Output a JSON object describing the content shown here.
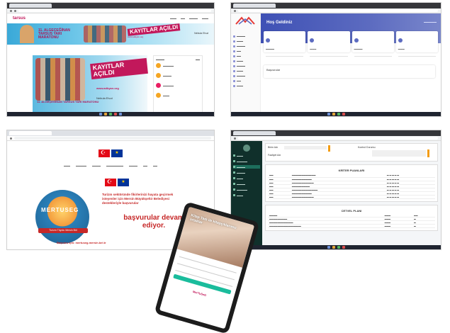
{
  "screen1": {
    "banner_title": "11. ALGEÇEĞİNAN TARSUS YARI MARATONU",
    "banner_cta": "KAYITLAR AÇILDI",
    "banner_web": "www.adkyarı.org",
    "banner_brand": "Nebula Eivət",
    "poster_cta": "KAYITLAR AÇILDI",
    "poster_title": "11. ALGEÇEĞİNAN TARSUS YARI MARATONU",
    "poster_web": "www.adkyarı.org",
    "poster_brand": "Nebula Eivət",
    "logo": "tarsus"
  },
  "screen2": {
    "header_title": "Hoş Geldiniz",
    "section_title": "Başvurular"
  },
  "screen3": {
    "hero_logo": "MERTUSEG",
    "hero_ribbon": "Turizm Tüyolu Mersin Bül",
    "hero_text1": "Turizm sektöründe fikirlerinizi hayata geçirmek isteyenler için Mersin Büyükşehir Belediyesi destekleriyle başvurular",
    "hero_text2": "başvurular devam ediyor.",
    "footer_text": "Başvuru için: mertuseg.mersin.bel.tr"
  },
  "screen4": {
    "field1": "Birim Adı",
    "field2": "Faaliyet Adı",
    "field3": "Kontrol Durumu",
    "table1_title": "KRİTER PUANLARI",
    "table2_title": "CETVEL PLANI"
  },
  "tablet": {
    "photo_text": "Kitap Tadı ile kitapçıklarımız ortaklar",
    "logo": "MerTuSeG"
  },
  "colors": {
    "accent_pink": "#c2185b",
    "accent_red": "#c62828",
    "indigo": "#3f51b5",
    "teal_dark": "#10302b"
  }
}
